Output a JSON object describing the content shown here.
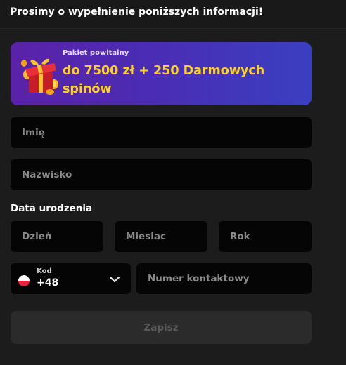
{
  "header": {
    "title": "Prosimy o wypełnienie poniższych informacji!"
  },
  "banner": {
    "subtitle": "Pakiet powitalny",
    "offer": "do 7500 zł + 250 Darmowych spinów",
    "icon": "gift-coins-icon"
  },
  "form": {
    "first_name_placeholder": "Imię",
    "last_name_placeholder": "Nazwisko",
    "dob_label": "Data urodzenia",
    "day_placeholder": "Dzień",
    "month_placeholder": "Miesiąc",
    "year_placeholder": "Rok",
    "phone_code_label": "Kod",
    "phone_code_value": "+48",
    "phone_flag": "poland-flag-icon",
    "phone_placeholder": "Numer kontaktowy",
    "submit_label": "Zapisz"
  },
  "colors": {
    "background": "#1c1c1c",
    "field": "#050505",
    "accent_yellow": "#ffd21f",
    "banner_start": "#5a22a8",
    "banner_end": "#3a3fc0"
  }
}
